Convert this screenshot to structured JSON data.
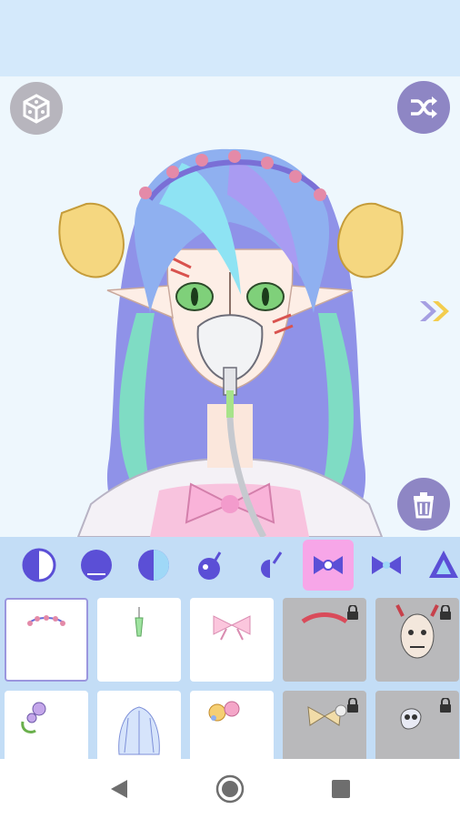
{
  "colors": {
    "top_bar": "#d4e9fb",
    "stage_bg": "#eef7fd",
    "tab_bar": "#c3ddf6",
    "tab_active": "#f7a6e8",
    "accent_purple": "#8e86c4",
    "random_gray": "#b7b5bd",
    "locked_tile": "#b9b9bb"
  },
  "toolbar": {
    "random_icon": "dice-icon",
    "shuffle_icon": "shuffle-icon",
    "delete_icon": "trash-icon",
    "next_icon": "double-chevron-right-icon"
  },
  "tabs": [
    {
      "icon": "eye-half-left-icon",
      "active": false
    },
    {
      "icon": "eye-round-icon",
      "active": false
    },
    {
      "icon": "eye-half-right-icon",
      "active": false
    },
    {
      "icon": "eye-accessory-left-icon",
      "active": false
    },
    {
      "icon": "eye-accessory-right-icon",
      "active": false
    },
    {
      "icon": "bow-icon",
      "active": true
    },
    {
      "icon": "bow-outline-icon",
      "active": false
    },
    {
      "icon": "triangle-icon",
      "active": false
    }
  ],
  "items": [
    {
      "icon": "bead-tiara-icon",
      "locked": false,
      "selected": true
    },
    {
      "icon": "earring-icon",
      "locked": false,
      "selected": false
    },
    {
      "icon": "hair-bow-icon",
      "locked": false,
      "selected": false
    },
    {
      "icon": "red-headband-icon",
      "locked": true,
      "selected": false
    },
    {
      "icon": "oni-mask-icon",
      "locked": true,
      "selected": false
    },
    {
      "icon": "rose-wreath-icon",
      "locked": false,
      "selected": false
    },
    {
      "icon": "veil-icon",
      "locked": false,
      "selected": false
    },
    {
      "icon": "flower-pin-icon",
      "locked": false,
      "selected": false
    },
    {
      "icon": "butterfly-clip-icon",
      "locked": true,
      "selected": false
    },
    {
      "icon": "skull-pin-icon",
      "locked": true,
      "selected": false
    }
  ],
  "navbar": {
    "back_icon": "back-triangle-icon",
    "home_icon": "home-circle-icon",
    "recents_icon": "recents-square-icon"
  }
}
